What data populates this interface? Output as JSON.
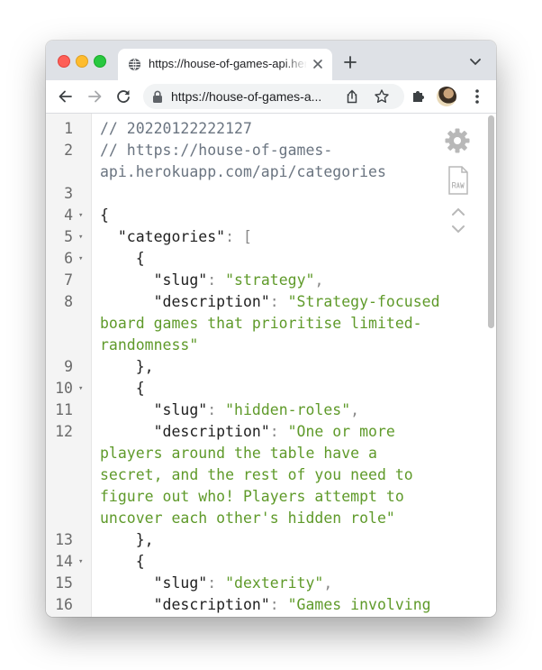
{
  "browser": {
    "tab_title": "https://house-of-games-api.herokuapp.com/api/categories",
    "url": "https://house-of-games-api.herokuapp.com/api/categories",
    "url_display": "https://house-of-games-a..."
  },
  "viewer": {
    "lines": [
      {
        "num": "1",
        "fold": "",
        "kind": "comment",
        "text": "// 20220122222127"
      },
      {
        "num": "2",
        "fold": "",
        "kind": "comment",
        "text": "// https://house-of-games-"
      },
      {
        "num": "",
        "fold": "",
        "kind": "comment",
        "text": "api.herokuapp.com/api/categories"
      },
      {
        "num": "3",
        "fold": "",
        "kind": "plain",
        "text": ""
      },
      {
        "num": "4",
        "fold": "▾",
        "kind": "plain",
        "text": "{"
      },
      {
        "num": "5",
        "fold": "▾",
        "kind": "keyopen",
        "indent": "  ",
        "key": "\"categories\"",
        "sep": ": ",
        "tail": "["
      },
      {
        "num": "6",
        "fold": "▾",
        "kind": "plain",
        "text": "    {"
      },
      {
        "num": "7",
        "fold": "",
        "kind": "pair",
        "indent": "      ",
        "key": "\"slug\"",
        "sep": ": ",
        "value": "\"strategy\"",
        "tail": ","
      },
      {
        "num": "8",
        "fold": "",
        "kind": "pair",
        "indent": "      ",
        "key": "\"description\"",
        "sep": ": ",
        "value": "\"Strategy-focused",
        "tail": ""
      },
      {
        "num": "",
        "fold": "",
        "kind": "string",
        "text": "board games that prioritise limited-"
      },
      {
        "num": "",
        "fold": "",
        "kind": "string",
        "text": "randomness\""
      },
      {
        "num": "9",
        "fold": "",
        "kind": "plain",
        "text": "    },"
      },
      {
        "num": "10",
        "fold": "▾",
        "kind": "plain",
        "text": "    {"
      },
      {
        "num": "11",
        "fold": "",
        "kind": "pair",
        "indent": "      ",
        "key": "\"slug\"",
        "sep": ": ",
        "value": "\"hidden-roles\"",
        "tail": ","
      },
      {
        "num": "12",
        "fold": "",
        "kind": "pair",
        "indent": "      ",
        "key": "\"description\"",
        "sep": ": ",
        "value": "\"One or more",
        "tail": ""
      },
      {
        "num": "",
        "fold": "",
        "kind": "string",
        "text": "players around the table have a"
      },
      {
        "num": "",
        "fold": "",
        "kind": "string",
        "text": "secret, and the rest of you need to"
      },
      {
        "num": "",
        "fold": "",
        "kind": "string",
        "text": "figure out who! Players attempt to"
      },
      {
        "num": "",
        "fold": "",
        "kind": "string",
        "text": "uncover each other's hidden role\""
      },
      {
        "num": "13",
        "fold": "",
        "kind": "plain",
        "text": "    },"
      },
      {
        "num": "14",
        "fold": "▾",
        "kind": "plain",
        "text": "    {"
      },
      {
        "num": "15",
        "fold": "",
        "kind": "pair",
        "indent": "      ",
        "key": "\"slug\"",
        "sep": ": ",
        "value": "\"dexterity\"",
        "tail": ","
      },
      {
        "num": "16",
        "fold": "",
        "kind": "pair",
        "indent": "      ",
        "key": "\"description\"",
        "sep": ": ",
        "value": "\"Games involving",
        "tail": ""
      }
    ]
  },
  "icons": {
    "favicon": "globe-icon",
    "tab_close": "close-icon",
    "new_tab": "plus-icon",
    "tab_search": "chevron-down-icon",
    "back": "arrow-left-icon",
    "forward": "arrow-right-icon",
    "reload": "reload-icon",
    "lock": "lock-icon",
    "share": "share-icon",
    "bookmark": "star-icon",
    "extensions": "puzzle-icon",
    "menu": "kebab-menu-icon",
    "settings": "gear-icon",
    "raw": "raw-file-icon",
    "collapse_expand": "chevron-up-down-icon"
  },
  "colors": {
    "string": "#5f9a2a",
    "comment": "#6a7480",
    "key": "#1f1f1f",
    "window_close": "#fe5f57",
    "window_minimize": "#febc2e",
    "window_zoom": "#28c840"
  }
}
